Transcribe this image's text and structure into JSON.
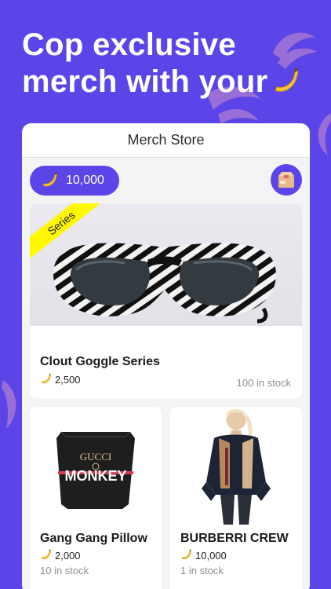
{
  "hero": {
    "line1": "Cop exclusive",
    "line2": "merch with your"
  },
  "store": {
    "title": "Merch Store",
    "balance": "10,000"
  },
  "featured": {
    "badge": "Series",
    "name": "Clout Goggle Series",
    "price": "2,500",
    "stock": "100 in stock"
  },
  "products": [
    {
      "name": "Gang Gang Pillow",
      "price": "2,000",
      "stock": "10 in stock",
      "print_top": "GUCCI",
      "print_main": "MONKEY"
    },
    {
      "name": "BURBERRI CREW",
      "price": "10,000",
      "stock": "1 in stock"
    }
  ],
  "icons": {
    "currency": "banana-icon",
    "inventory": "box-icon"
  },
  "colors": {
    "brand": "#5b45e8",
    "ribbon": "#fff800",
    "banana": "#f7c531"
  }
}
